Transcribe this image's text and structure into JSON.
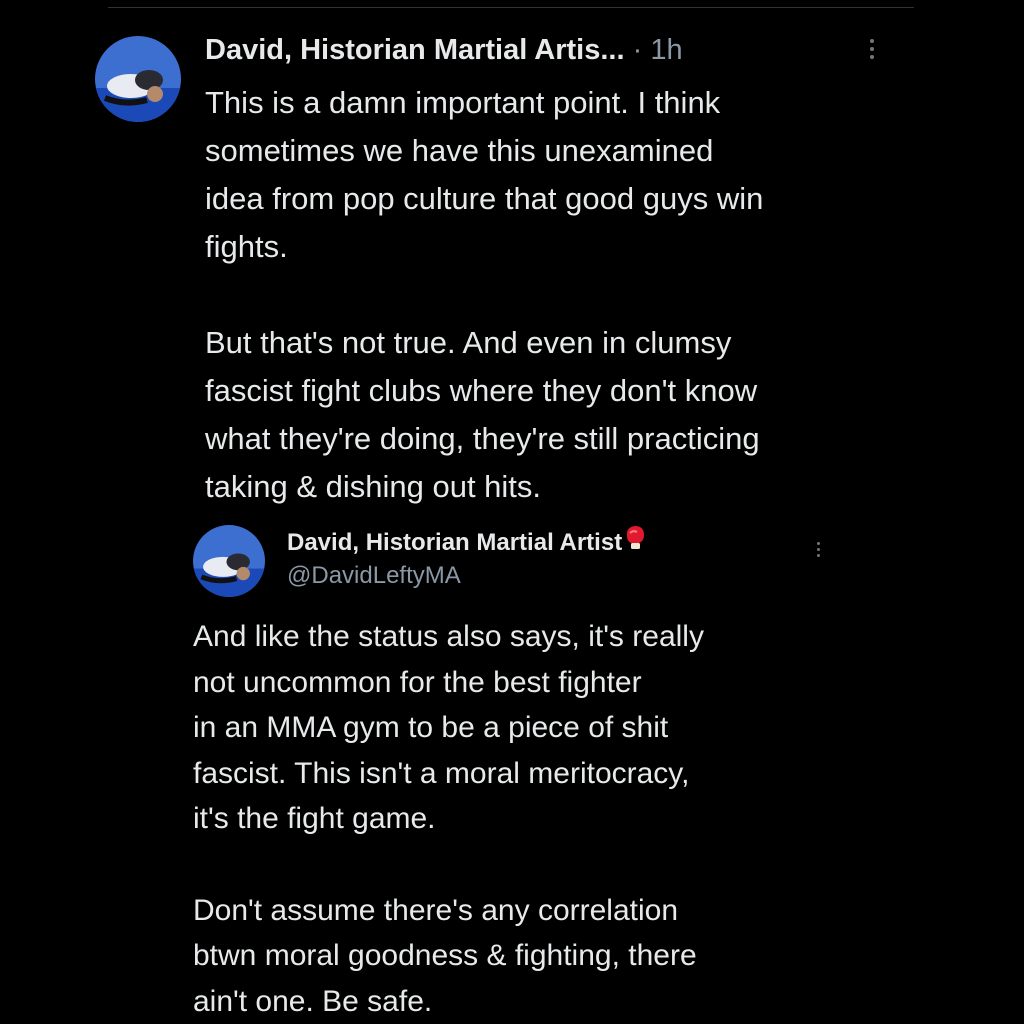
{
  "reply": {
    "author_name": "David, Historian Martial Artis...",
    "separator": "·",
    "time": "1h",
    "text_lines": [
      "This is a damn important point. I think",
      "sometimes we have this unexamined",
      "idea from pop culture that good guys win",
      "fights.",
      "",
      "But that's not true. And even in clumsy",
      "fascist fight clubs where they don't know",
      "what they're doing, they're still practicing",
      "taking & dishing out hits."
    ]
  },
  "quoted": {
    "author_name": "David, Historian Martial Artist",
    "badge_emoji": "🥊",
    "handle": "@DavidLeftyMA",
    "text_lines": [
      "And like the status also says, it's really",
      "not uncommon for the best fighter",
      "in an MMA gym to be a piece of shit",
      "fascist. This isn't a moral meritocracy,",
      "it's the fight game.",
      "",
      "Don't assume there's any correlation",
      "btwn moral goodness & fighting, there",
      "ain't one. Be safe."
    ]
  },
  "icons": {
    "more": "more-vertical-icon",
    "badge": "boxing-glove-icon"
  },
  "colors": {
    "background": "#000000",
    "text": "#e7e9ea",
    "muted": "#8b98a5",
    "divider": "#2f3336",
    "glove": "#e0192f"
  }
}
